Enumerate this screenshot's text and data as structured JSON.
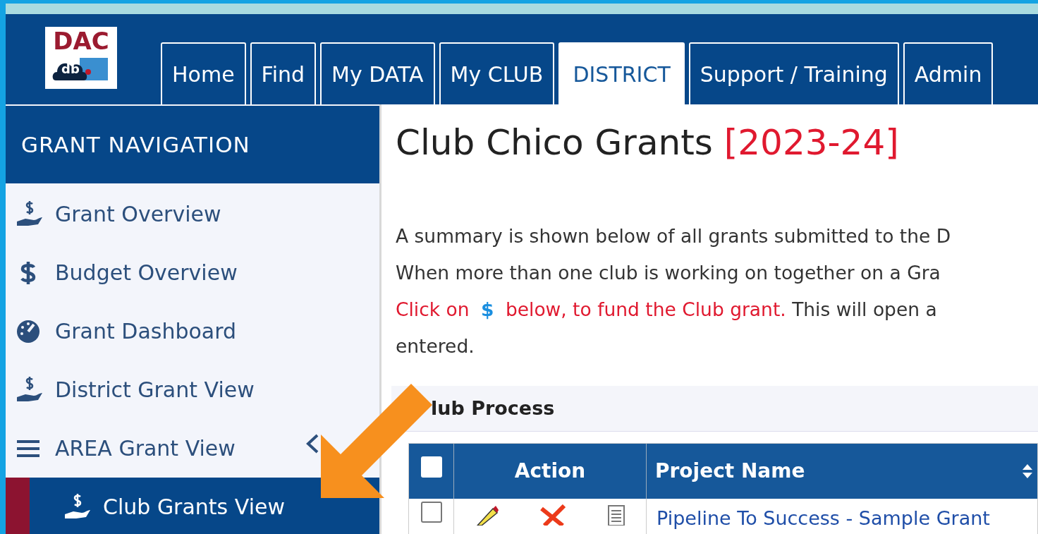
{
  "logo": {
    "title": "DAC",
    "badge": "db"
  },
  "tabs": [
    {
      "label": "Home",
      "selected": false
    },
    {
      "label": "Find",
      "selected": false
    },
    {
      "label": "My DATA",
      "selected": false
    },
    {
      "label": "My CLUB",
      "selected": false
    },
    {
      "label": "DISTRICT",
      "selected": true
    },
    {
      "label": "Support / Training",
      "selected": false
    },
    {
      "label": "Admin",
      "selected": false
    }
  ],
  "sidebar": {
    "title": "GRANT NAVIGATION",
    "items": [
      {
        "label": "Grant Overview",
        "selected": false
      },
      {
        "label": "Budget Overview",
        "selected": false
      },
      {
        "label": "Grant Dashboard",
        "selected": false
      },
      {
        "label": "District Grant View",
        "selected": false
      },
      {
        "label": "AREA Grant View",
        "selected": false
      },
      {
        "label": "Club Grants View",
        "selected": true
      }
    ]
  },
  "page": {
    "title": "Club Chico Grants",
    "year": "[2023-24]",
    "intro_lines": [
      [
        {
          "text": "A summary is shown below of all grants submitted to the D",
          "kind": "plain"
        }
      ],
      [
        {
          "text": "When more than one club is working on together on a Gra",
          "kind": "plain"
        }
      ],
      [
        {
          "text": "Click on ",
          "kind": "alert"
        },
        {
          "text": "$",
          "kind": "symbol"
        },
        {
          "text": " below, to fund the Club grant.",
          "kind": "alert"
        },
        {
          "text": " This will open a",
          "kind": "plain"
        }
      ],
      [
        {
          "text": "entered.",
          "kind": "plain"
        }
      ]
    ]
  },
  "panel": {
    "title": "lub Process"
  },
  "table": {
    "select_all": {
      "checked": false
    },
    "columns": [
      {
        "label": "Action",
        "sortable": false
      },
      {
        "label": "Project Name",
        "sortable": true
      }
    ],
    "rows": [
      {
        "checked": false,
        "project": "Pipeline To Success - Sample Grant"
      }
    ]
  }
}
